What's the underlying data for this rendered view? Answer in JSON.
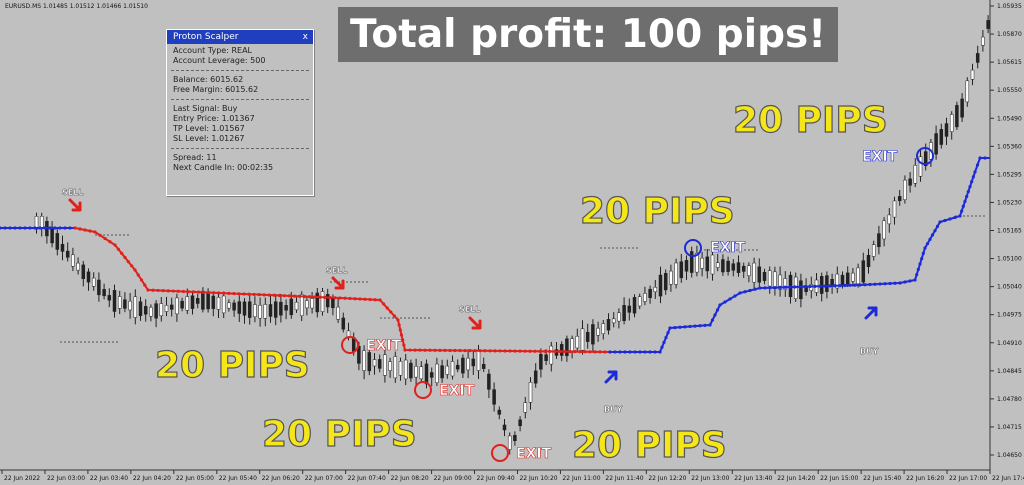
{
  "chart_header": {
    "symbol_info": "EURUSD.MS  1.01485 1.01512 1.01466 1.01510"
  },
  "banner": {
    "text": "Total profit: 100 pips!"
  },
  "panel": {
    "title": "Proton Scalper",
    "close_glyph": "x",
    "account_type": "Account Type: REAL",
    "account_leverage": "Account Leverage: 500",
    "balance": "Balance: 6015.62",
    "free_margin": "Free Margin: 6015.62",
    "last_signal": "Last Signal: Buy",
    "entry_price": "Entry Price: 1.01367",
    "tp_level": "TP Level: 1.01567",
    "sl_level": "SL Level: 1.01267",
    "spread": "Spread: 11",
    "next_candle": "Next Candle In: 00:02:35"
  },
  "labels": {
    "sell": "SELL",
    "buy": "BUY",
    "exit": "EXIT",
    "pips": "20 PIPS"
  },
  "price_axis": [
    "1.05935",
    "1.05870",
    "1.05615",
    "1.05550",
    "1.05490",
    "1.05360",
    "1.05295",
    "1.05230",
    "1.05165",
    "1.05100",
    "1.05040",
    "1.04975",
    "1.04910",
    "1.04845",
    "1.04780",
    "1.04715",
    "1.04650"
  ],
  "time_axis": [
    "22 Jun 2022",
    "22 Jun 03:00",
    "22 Jun 03:40",
    "22 Jun 04:20",
    "22 Jun 05:00",
    "22 Jun 05:40",
    "22 Jun 06:20",
    "22 Jun 07:00",
    "22 Jun 07:40",
    "22 Jun 08:20",
    "22 Jun 09:00",
    "22 Jun 09:40",
    "22 Jun 10:20",
    "22 Jun 11:00",
    "22 Jun 11:40",
    "22 Jun 12:20",
    "22 Jun 13:00",
    "22 Jun 13:40",
    "22 Jun 14:20",
    "22 Jun 15:00",
    "22 Jun 15:40",
    "22 Jun 16:20",
    "22 Jun 17:00",
    "22 Jun 17:40"
  ],
  "colors": {
    "sell_line": "#e0201c",
    "buy_line": "#1c2ad8",
    "pips_text": "#f5e61a",
    "exit_red": "#e0201c",
    "exit_blue": "#1c2ad8",
    "up_candle": "#ffffff",
    "down_candle": "#222222",
    "background": "#c0c0c0"
  }
}
